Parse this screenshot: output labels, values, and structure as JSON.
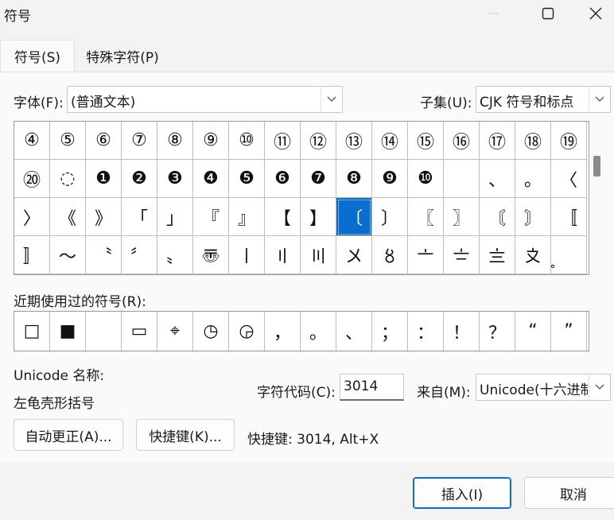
{
  "window": {
    "title": "符号"
  },
  "tabs": [
    {
      "label": "符号(S)",
      "active": true
    },
    {
      "label": "特殊字符(P)",
      "active": false
    }
  ],
  "font": {
    "label": "字体(F):",
    "value": "(普通文本)"
  },
  "subset": {
    "label": "子集(U):",
    "value": "CJK 符号和标点"
  },
  "symbol_grid": {
    "rows": [
      [
        "④",
        "⑤",
        "⑥",
        "⑦",
        "⑧",
        "⑨",
        "⑩",
        "⑪",
        "⑫",
        "⑬",
        "⑭",
        "⑮",
        "⑯",
        "⑰",
        "⑱",
        "⑲"
      ],
      [
        "⑳",
        "◌",
        "❶",
        "❷",
        "❸",
        "❹",
        "❺",
        "❻",
        "❼",
        "❽",
        "❾",
        "❿",
        "",
        "、",
        "。",
        "〈"
      ],
      [
        "〉",
        "《",
        "》",
        "「",
        "」",
        "『",
        "』",
        "【",
        "】",
        "〔",
        "〕",
        "〖",
        "〗",
        "〘",
        "〙",
        "〚"
      ],
      [
        "〛",
        "〜",
        "〝",
        "〞",
        "〟",
        "〠",
        "〡",
        "〢",
        "〣",
        "〤",
        "〥",
        "〦",
        "〧",
        "〨",
        "〩",
        "〪"
      ]
    ],
    "selected": {
      "row": 2,
      "col": 9
    }
  },
  "recent": {
    "label": "近期使用过的符号(R):",
    "symbols": [
      "□",
      "■",
      "",
      "▭",
      "⌖",
      "◷",
      "◶",
      "，",
      "。",
      "、",
      "；",
      "：",
      "！",
      "？",
      "“",
      "”"
    ]
  },
  "unicode_name": {
    "label": "Unicode 名称:",
    "value": "左龟壳形括号"
  },
  "char_code": {
    "label": "字符代码(C):",
    "value": "3014"
  },
  "from": {
    "label": "来自(M):",
    "value": "Unicode(十六进制)"
  },
  "buttons": {
    "autocorrect": "自动更正(A)...",
    "shortcut_key": "快捷键(K)...",
    "insert": "插入(I)",
    "cancel": "取消"
  },
  "shortcut_info": "快捷键: 3014, Alt+X",
  "colors": {
    "selection": "#0a6ed1",
    "panel": "#fafafa",
    "background": "#f3f3f3"
  }
}
